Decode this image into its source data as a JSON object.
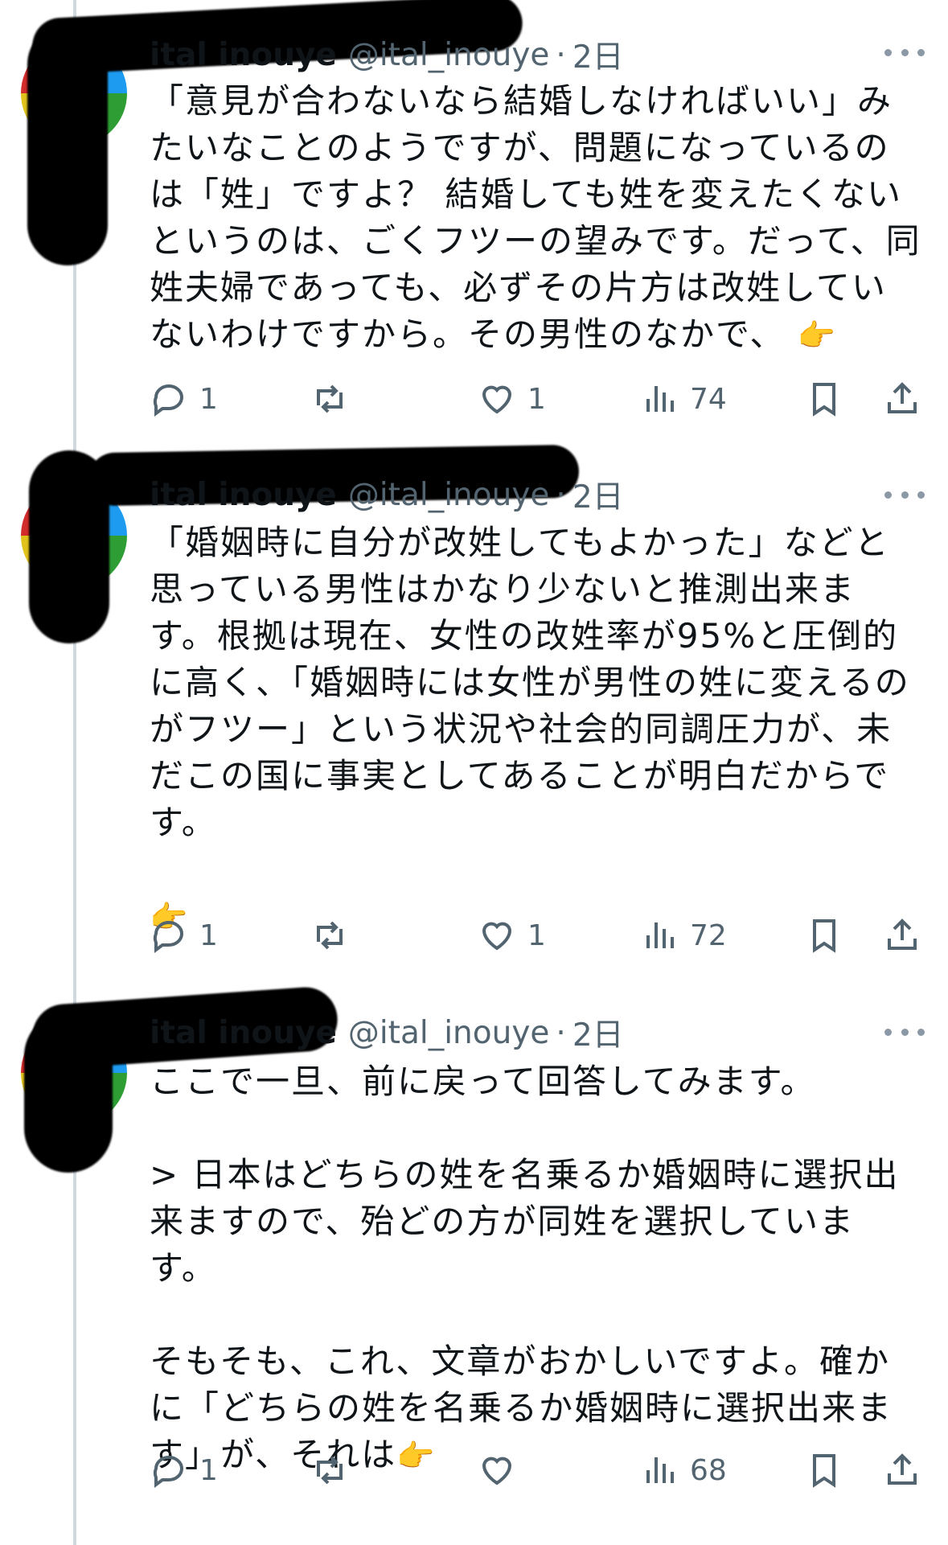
{
  "tweets": [
    {
      "name": "ital inouye",
      "handle": "@ital_inouye",
      "dot": "·",
      "time": "2日",
      "text": "「意見が合わないなら結婚しなければいい」みたいなことのようですが、問題になっているのは「姓」ですよ？ 結婚しても姓を変えたくないというのは、ごくフツーの望みです。だって、同姓夫婦であっても、必ずその片方は改姓していないわけですから。その男性のなかで、",
      "pointer": "👉",
      "replies": "1",
      "reposts": "",
      "likes": "1",
      "views": "74"
    },
    {
      "name": "ital inouye",
      "handle": "@ital_inouye",
      "dot": "·",
      "time": "2日",
      "text": "「婚姻時に自分が改姓してもよかった」などと思っている男性はかなり少ないと推測出来ます。根拠は現在、女性の改姓率が95%と圧倒的に高く、「婚姻時には女性が男性の姓に変えるのがフツー」という状況や社会的同調圧力が、未だこの国に事実としてあることが明白だからです。\n\n",
      "pointer": "👉",
      "replies": "1",
      "reposts": "",
      "likes": "1",
      "views": "72"
    },
    {
      "name": "ital inouye",
      "handle": "@ital_inouye",
      "dot": "·",
      "time": "2日",
      "text": "ここで一旦、前に戻って回答してみます。\n\n> 日本はどちらの姓を名乗るか婚姻時に選択出来ますので、殆どの方が同姓を選択しています。\n\nそもそも、これ、文章がおかしいですよ。確かに「どちらの姓を名乗るか婚姻時に選択出来ます」が、それは",
      "pointer": "👉",
      "replies": "1",
      "reposts": "",
      "likes": "",
      "views": "68"
    }
  ],
  "icons": {
    "reply": "reply-icon",
    "repost": "repost-icon",
    "like": "heart-icon",
    "views": "views-icon",
    "bookmark": "bookmark-icon",
    "share": "share-icon",
    "more": "more-icon"
  },
  "colors": {
    "text": "#0f1419",
    "secondary": "#536471",
    "thread_line": "#cfd9de"
  }
}
